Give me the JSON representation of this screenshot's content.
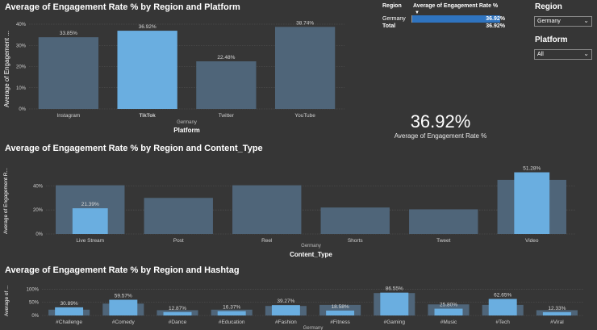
{
  "colors": {
    "bg": "#363636",
    "bar_dark": "#4f6579",
    "bar_light": "#6aaee0",
    "grid": "#555555",
    "highlight": "#2f74c0"
  },
  "slicers": {
    "region": {
      "label": "Region",
      "value": "Germany"
    },
    "platform": {
      "label": "Platform",
      "value": "All"
    }
  },
  "matrix": {
    "col_region": "Region",
    "col_measure": "Average of Engagement Rate %",
    "row1_label": "Germany",
    "row1_value": "36.92%",
    "row2_label": "Total",
    "row2_value": "36.92%",
    "row1_fill": 0.95
  },
  "card": {
    "value": "36.92%",
    "label": "Average of Engagement Rate %"
  },
  "chart_data": [
    {
      "type": "bar",
      "title": "Average of Engagement Rate % by Region and Platform",
      "ylabel": "Average of Engagement ...",
      "xlabel": "Platform",
      "legend_label": "Germany",
      "categories": [
        "Instagram",
        "TikTok",
        "Twitter",
        "YouTube"
      ],
      "yticks": [
        "0%",
        "10%",
        "20%",
        "30%",
        "40%"
      ],
      "ylim": [
        0,
        40
      ],
      "series": [
        {
          "values": [
            33.85,
            36.92,
            22.48,
            38.74
          ]
        }
      ],
      "labels": [
        "33.85%",
        "36.92%",
        "22.48%",
        "38.74%"
      ],
      "highlighted": [
        false,
        true,
        false,
        false
      ],
      "grid": true
    },
    {
      "type": "bar",
      "title": "Average of Engagement Rate % by Region and Content_Type",
      "ylabel": "Average of Engagement R...",
      "xlabel": "Content_Type",
      "legend_label": "Germany",
      "categories": [
        "Live Stream",
        "Post",
        "Reel",
        "Shorts",
        "Tweet",
        "Video"
      ],
      "yticks": [
        "0%",
        "20%",
        "40%"
      ],
      "ylim": [
        0,
        55
      ],
      "series": [
        {
          "values": [
            40.5,
            30.0,
            40.5,
            22.0,
            20.5,
            45.0
          ]
        },
        {
          "values": [
            21.39,
            null,
            null,
            null,
            null,
            51.28
          ]
        }
      ],
      "labels": [
        "21.39%",
        "",
        "",
        "",
        "",
        "51.28%"
      ],
      "grid": true
    },
    {
      "type": "bar",
      "title": "Average of Engagement Rate % by Region and Hashtag",
      "ylabel": "Average of ...",
      "xlabel": "",
      "legend_label": "Germany",
      "categories": [
        "#Challenge",
        "#Comedy",
        "#Dance",
        "#Education",
        "#Fashion",
        "#Fitness",
        "#Gaming",
        "#Music",
        "#Tech",
        "#Viral"
      ],
      "yticks": [
        "0%",
        "50%",
        "100%"
      ],
      "ylim": [
        0,
        110
      ],
      "series": [
        {
          "values": [
            22,
            45,
            20,
            22,
            36,
            40,
            85,
            42,
            40,
            20
          ]
        },
        {
          "values": [
            30.89,
            59.57,
            12.87,
            16.37,
            39.27,
            18.58,
            86.55,
            25.8,
            62.65,
            12.33
          ]
        }
      ],
      "labels": [
        "30.89%",
        "59.57%",
        "12.87%",
        "16.37%",
        "39.27%",
        "18.58%",
        "86.55%",
        "25.80%",
        "62.65%",
        "12.33%"
      ],
      "grid": true
    }
  ]
}
